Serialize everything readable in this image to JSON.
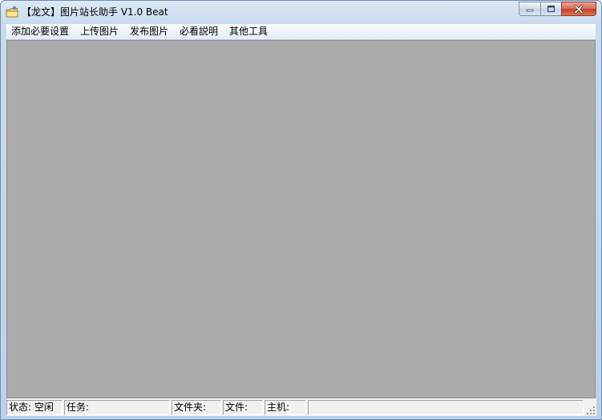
{
  "window": {
    "title": "【龙文】图片站长助手 V1.0 Beat",
    "icons": {
      "app": "folder-app-icon",
      "minimize": "minimize-icon",
      "maximize": "maximize-icon",
      "close": "close-icon"
    }
  },
  "menu": {
    "items": [
      {
        "label": "添加必要设置"
      },
      {
        "label": "上传图片"
      },
      {
        "label": "发布图片"
      },
      {
        "label": "必看説明"
      },
      {
        "label": "其他工具"
      }
    ]
  },
  "status": {
    "state": "状态: 空闲",
    "task": "任务:",
    "folder": "文件夹:",
    "file": "文件:",
    "host": "主机:",
    "extra": ""
  },
  "colors": {
    "client_background": "#ababab",
    "close_button": "#c4402b",
    "frame": "#bcd1e8"
  }
}
